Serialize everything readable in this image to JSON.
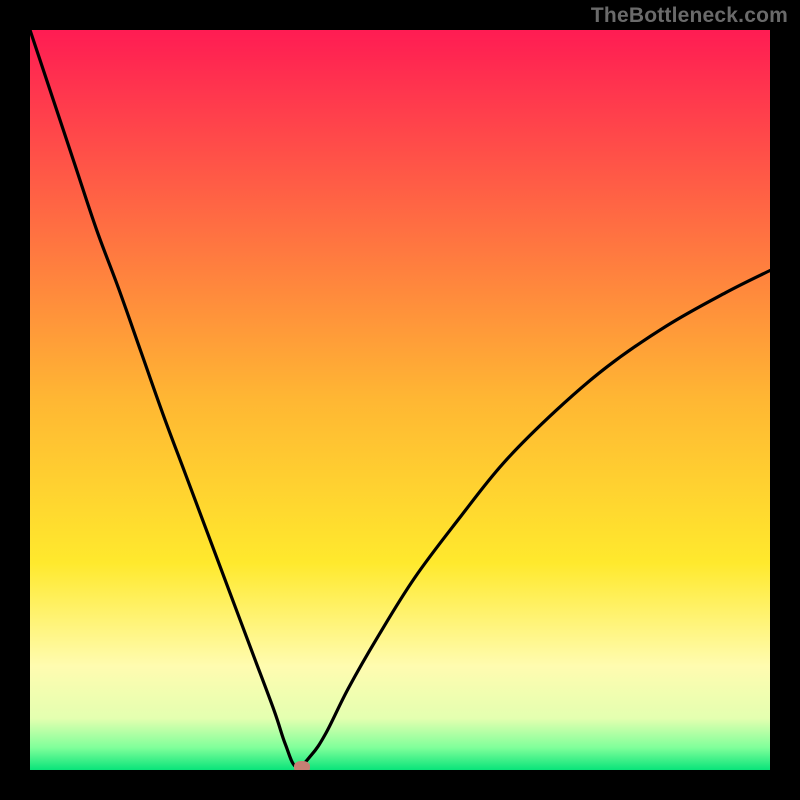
{
  "watermark": "TheBottleneck.com",
  "chart_data": {
    "type": "line",
    "title": "",
    "xlabel": "",
    "ylabel": "",
    "xlim": [
      0,
      100
    ],
    "ylim": [
      0,
      100
    ],
    "legend": false,
    "grid": false,
    "background_gradient": {
      "stops": [
        {
          "pct": 0,
          "color": "#ff1c53"
        },
        {
          "pct": 50,
          "color": "#ffb733"
        },
        {
          "pct": 72,
          "color": "#ffe92d"
        },
        {
          "pct": 86,
          "color": "#fffcb0"
        },
        {
          "pct": 93,
          "color": "#e4ffb0"
        },
        {
          "pct": 97,
          "color": "#7fff9a"
        },
        {
          "pct": 100,
          "color": "#09e47a"
        }
      ]
    },
    "series": [
      {
        "name": "bottleneck-curve",
        "color": "#000000",
        "x": [
          0,
          3,
          6,
          9,
          12,
          15,
          18,
          21,
          24,
          27,
          30,
          33,
          34.5,
          36,
          38,
          40,
          43,
          47,
          52,
          58,
          64,
          71,
          78,
          86,
          94,
          100
        ],
        "y": [
          100,
          91,
          82,
          73,
          65,
          56.5,
          48,
          40,
          32,
          24,
          16,
          8,
          3.5,
          0.4,
          2,
          5,
          11,
          18,
          26,
          34,
          41.5,
          48.5,
          54.5,
          60,
          64.5,
          67.5
        ]
      }
    ],
    "marker": {
      "x": 36.8,
      "y": 0.4,
      "color": "#c58074"
    }
  }
}
